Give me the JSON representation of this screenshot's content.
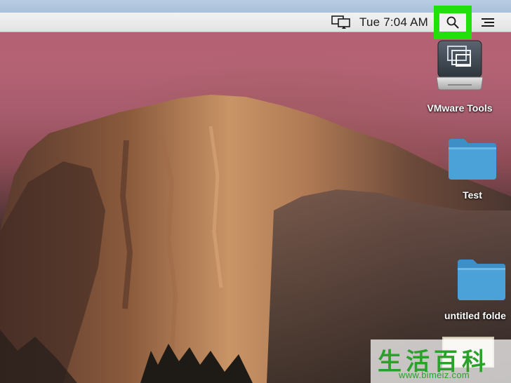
{
  "menubar": {
    "clock": "Tue 7:04 AM",
    "icons": {
      "airplay": "display-mirroring-icon",
      "spotlight": "search-icon",
      "notification_center": "list-icon"
    },
    "highlight_color": "#21e00c"
  },
  "desktop": {
    "items": [
      {
        "label": "VMware Tools",
        "icon": "vmware-tools-disk-icon"
      },
      {
        "label": "Test",
        "icon": "folder-icon"
      },
      {
        "label": "untitled folde",
        "icon": "folder-icon"
      }
    ],
    "folder_color": "#4aa2d8"
  },
  "watermark": {
    "chars": [
      "生",
      "活",
      "百",
      "科"
    ],
    "url": "www.bimeiz.com"
  }
}
